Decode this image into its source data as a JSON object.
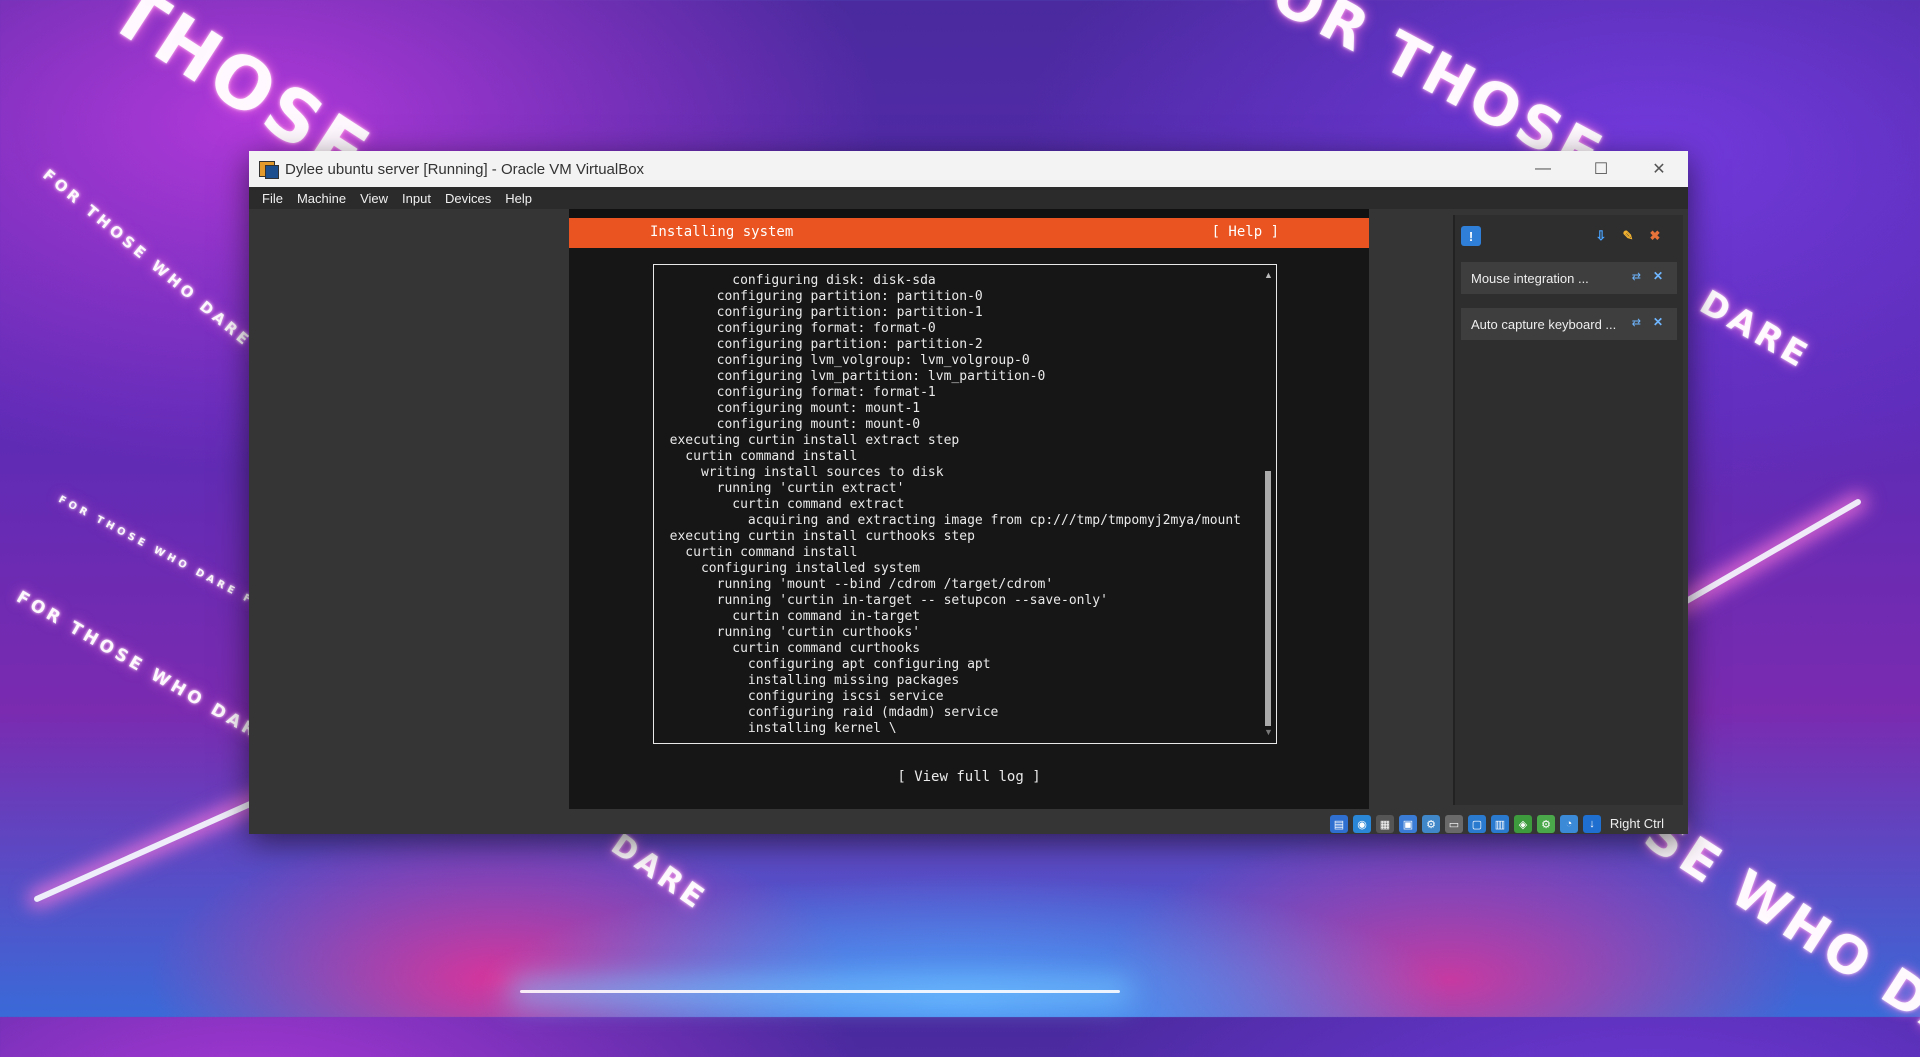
{
  "background": {
    "phrases": [
      "THOSE",
      "FOR THOSE",
      "FOR THOSE WHO DARE FOR THOSE WHO",
      "FOR THOSE WHO DARE FOR THOSE WHO DARE",
      "FOR THOSE WHO DARE FOR THO",
      "DARE",
      "DARE",
      "SE WHO DA"
    ]
  },
  "window": {
    "title": "Dylee ubuntu server [Running] - Oracle VM VirtualBox",
    "buttons": {
      "minimize": "—",
      "maximize": "☐",
      "close": "✕"
    }
  },
  "menu": {
    "items": [
      "File",
      "Machine",
      "View",
      "Input",
      "Devices",
      "Help"
    ]
  },
  "installer": {
    "title": "Installing system",
    "help": "[ Help ]",
    "log_lines": [
      "          configuring disk: disk-sda",
      "        configuring partition: partition-0",
      "        configuring partition: partition-1",
      "        configuring format: format-0",
      "        configuring partition: partition-2",
      "        configuring lvm_volgroup: lvm_volgroup-0",
      "        configuring lvm_partition: lvm_partition-0",
      "        configuring format: format-1",
      "        configuring mount: mount-1",
      "        configuring mount: mount-0",
      "  executing curtin install extract step",
      "    curtin command install",
      "      writing install sources to disk",
      "        running 'curtin extract'",
      "          curtin command extract",
      "            acquiring and extracting image from cp:///tmp/tmpomyj2mya/mount",
      "  executing curtin install curthooks step",
      "    curtin command install",
      "      configuring installed system",
      "        running 'mount --bind /cdrom /target/cdrom'",
      "        running 'curtin in-target -- setupcon --save-only'",
      "          curtin command in-target",
      "        running 'curtin curthooks'",
      "          curtin command curthooks",
      "            configuring apt configuring apt",
      "            installing missing packages",
      "            configuring iscsi service",
      "            configuring raid (mdadm) service",
      "            installing kernel \\"
    ],
    "view_full_log": "[ View full log ]"
  },
  "notifications": {
    "items": [
      {
        "text": "Mouse integration ..."
      },
      {
        "text": "Auto capture keyboard ..."
      }
    ]
  },
  "statusbar": {
    "host_key": "Right Ctrl",
    "icons": [
      "hard-disk-icon",
      "optical-drive-icon",
      "audio-icon",
      "network-icon",
      "usb-icon",
      "shared-folders-icon",
      "display-icon",
      "video-capture-icon",
      "recording-icon",
      "cpu-icon",
      "mouse-integration-icon",
      "keyboard-capture-icon"
    ]
  }
}
